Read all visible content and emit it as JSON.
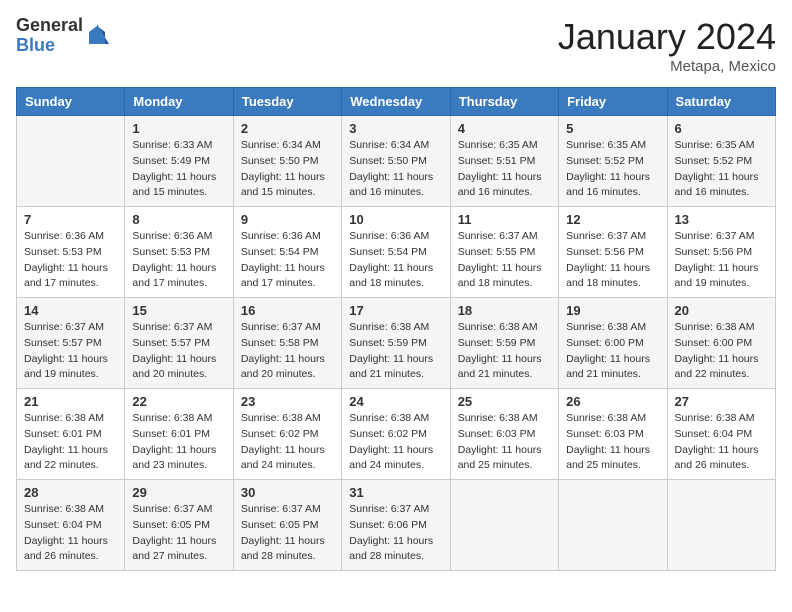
{
  "logo": {
    "general": "General",
    "blue": "Blue"
  },
  "title": "January 2024",
  "location": "Metapa, Mexico",
  "days_of_week": [
    "Sunday",
    "Monday",
    "Tuesday",
    "Wednesday",
    "Thursday",
    "Friday",
    "Saturday"
  ],
  "weeks": [
    [
      {
        "num": "",
        "sunrise": "",
        "sunset": "",
        "daylight": ""
      },
      {
        "num": "1",
        "sunrise": "Sunrise: 6:33 AM",
        "sunset": "Sunset: 5:49 PM",
        "daylight": "Daylight: 11 hours and 15 minutes."
      },
      {
        "num": "2",
        "sunrise": "Sunrise: 6:34 AM",
        "sunset": "Sunset: 5:50 PM",
        "daylight": "Daylight: 11 hours and 15 minutes."
      },
      {
        "num": "3",
        "sunrise": "Sunrise: 6:34 AM",
        "sunset": "Sunset: 5:50 PM",
        "daylight": "Daylight: 11 hours and 16 minutes."
      },
      {
        "num": "4",
        "sunrise": "Sunrise: 6:35 AM",
        "sunset": "Sunset: 5:51 PM",
        "daylight": "Daylight: 11 hours and 16 minutes."
      },
      {
        "num": "5",
        "sunrise": "Sunrise: 6:35 AM",
        "sunset": "Sunset: 5:52 PM",
        "daylight": "Daylight: 11 hours and 16 minutes."
      },
      {
        "num": "6",
        "sunrise": "Sunrise: 6:35 AM",
        "sunset": "Sunset: 5:52 PM",
        "daylight": "Daylight: 11 hours and 16 minutes."
      }
    ],
    [
      {
        "num": "7",
        "sunrise": "Sunrise: 6:36 AM",
        "sunset": "Sunset: 5:53 PM",
        "daylight": "Daylight: 11 hours and 17 minutes."
      },
      {
        "num": "8",
        "sunrise": "Sunrise: 6:36 AM",
        "sunset": "Sunset: 5:53 PM",
        "daylight": "Daylight: 11 hours and 17 minutes."
      },
      {
        "num": "9",
        "sunrise": "Sunrise: 6:36 AM",
        "sunset": "Sunset: 5:54 PM",
        "daylight": "Daylight: 11 hours and 17 minutes."
      },
      {
        "num": "10",
        "sunrise": "Sunrise: 6:36 AM",
        "sunset": "Sunset: 5:54 PM",
        "daylight": "Daylight: 11 hours and 18 minutes."
      },
      {
        "num": "11",
        "sunrise": "Sunrise: 6:37 AM",
        "sunset": "Sunset: 5:55 PM",
        "daylight": "Daylight: 11 hours and 18 minutes."
      },
      {
        "num": "12",
        "sunrise": "Sunrise: 6:37 AM",
        "sunset": "Sunset: 5:56 PM",
        "daylight": "Daylight: 11 hours and 18 minutes."
      },
      {
        "num": "13",
        "sunrise": "Sunrise: 6:37 AM",
        "sunset": "Sunset: 5:56 PM",
        "daylight": "Daylight: 11 hours and 19 minutes."
      }
    ],
    [
      {
        "num": "14",
        "sunrise": "Sunrise: 6:37 AM",
        "sunset": "Sunset: 5:57 PM",
        "daylight": "Daylight: 11 hours and 19 minutes."
      },
      {
        "num": "15",
        "sunrise": "Sunrise: 6:37 AM",
        "sunset": "Sunset: 5:57 PM",
        "daylight": "Daylight: 11 hours and 20 minutes."
      },
      {
        "num": "16",
        "sunrise": "Sunrise: 6:37 AM",
        "sunset": "Sunset: 5:58 PM",
        "daylight": "Daylight: 11 hours and 20 minutes."
      },
      {
        "num": "17",
        "sunrise": "Sunrise: 6:38 AM",
        "sunset": "Sunset: 5:59 PM",
        "daylight": "Daylight: 11 hours and 21 minutes."
      },
      {
        "num": "18",
        "sunrise": "Sunrise: 6:38 AM",
        "sunset": "Sunset: 5:59 PM",
        "daylight": "Daylight: 11 hours and 21 minutes."
      },
      {
        "num": "19",
        "sunrise": "Sunrise: 6:38 AM",
        "sunset": "Sunset: 6:00 PM",
        "daylight": "Daylight: 11 hours and 21 minutes."
      },
      {
        "num": "20",
        "sunrise": "Sunrise: 6:38 AM",
        "sunset": "Sunset: 6:00 PM",
        "daylight": "Daylight: 11 hours and 22 minutes."
      }
    ],
    [
      {
        "num": "21",
        "sunrise": "Sunrise: 6:38 AM",
        "sunset": "Sunset: 6:01 PM",
        "daylight": "Daylight: 11 hours and 22 minutes."
      },
      {
        "num": "22",
        "sunrise": "Sunrise: 6:38 AM",
        "sunset": "Sunset: 6:01 PM",
        "daylight": "Daylight: 11 hours and 23 minutes."
      },
      {
        "num": "23",
        "sunrise": "Sunrise: 6:38 AM",
        "sunset": "Sunset: 6:02 PM",
        "daylight": "Daylight: 11 hours and 24 minutes."
      },
      {
        "num": "24",
        "sunrise": "Sunrise: 6:38 AM",
        "sunset": "Sunset: 6:02 PM",
        "daylight": "Daylight: 11 hours and 24 minutes."
      },
      {
        "num": "25",
        "sunrise": "Sunrise: 6:38 AM",
        "sunset": "Sunset: 6:03 PM",
        "daylight": "Daylight: 11 hours and 25 minutes."
      },
      {
        "num": "26",
        "sunrise": "Sunrise: 6:38 AM",
        "sunset": "Sunset: 6:03 PM",
        "daylight": "Daylight: 11 hours and 25 minutes."
      },
      {
        "num": "27",
        "sunrise": "Sunrise: 6:38 AM",
        "sunset": "Sunset: 6:04 PM",
        "daylight": "Daylight: 11 hours and 26 minutes."
      }
    ],
    [
      {
        "num": "28",
        "sunrise": "Sunrise: 6:38 AM",
        "sunset": "Sunset: 6:04 PM",
        "daylight": "Daylight: 11 hours and 26 minutes."
      },
      {
        "num": "29",
        "sunrise": "Sunrise: 6:37 AM",
        "sunset": "Sunset: 6:05 PM",
        "daylight": "Daylight: 11 hours and 27 minutes."
      },
      {
        "num": "30",
        "sunrise": "Sunrise: 6:37 AM",
        "sunset": "Sunset: 6:05 PM",
        "daylight": "Daylight: 11 hours and 28 minutes."
      },
      {
        "num": "31",
        "sunrise": "Sunrise: 6:37 AM",
        "sunset": "Sunset: 6:06 PM",
        "daylight": "Daylight: 11 hours and 28 minutes."
      },
      {
        "num": "",
        "sunrise": "",
        "sunset": "",
        "daylight": ""
      },
      {
        "num": "",
        "sunrise": "",
        "sunset": "",
        "daylight": ""
      },
      {
        "num": "",
        "sunrise": "",
        "sunset": "",
        "daylight": ""
      }
    ]
  ]
}
